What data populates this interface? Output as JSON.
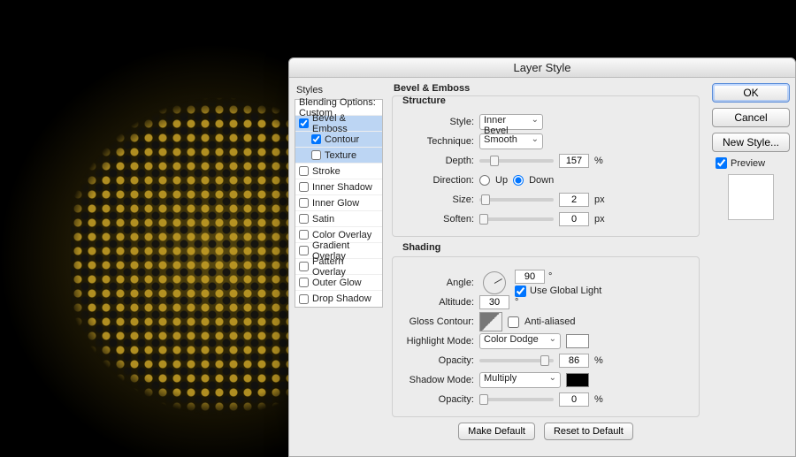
{
  "dialog": {
    "title": "Layer Style",
    "styles_label": "Styles",
    "blending_label": "Blending Options: Custom",
    "effects": [
      {
        "label": "Bevel & Emboss",
        "checked": true,
        "selected": true
      },
      {
        "label": "Contour",
        "checked": true,
        "sub": true,
        "selected": true
      },
      {
        "label": "Texture",
        "checked": false,
        "sub": true,
        "selected": true
      },
      {
        "label": "Stroke",
        "checked": false
      },
      {
        "label": "Inner Shadow",
        "checked": false
      },
      {
        "label": "Inner Glow",
        "checked": false
      },
      {
        "label": "Satin",
        "checked": false
      },
      {
        "label": "Color Overlay",
        "checked": false
      },
      {
        "label": "Gradient Overlay",
        "checked": false
      },
      {
        "label": "Pattern Overlay",
        "checked": false
      },
      {
        "label": "Outer Glow",
        "checked": false
      },
      {
        "label": "Drop Shadow",
        "checked": false
      }
    ]
  },
  "structure": {
    "section": "Bevel & Emboss",
    "sub": "Structure",
    "style_lbl": "Style:",
    "style_val": "Inner Bevel",
    "technique_lbl": "Technique:",
    "technique_val": "Smooth",
    "depth_lbl": "Depth:",
    "depth_val": "157",
    "depth_unit": "%",
    "direction_lbl": "Direction:",
    "up": "Up",
    "down": "Down",
    "size_lbl": "Size:",
    "size_val": "2",
    "size_unit": "px",
    "soften_lbl": "Soften:",
    "soften_val": "0",
    "soften_unit": "px"
  },
  "shading": {
    "sub": "Shading",
    "angle_lbl": "Angle:",
    "angle_val": "90",
    "global": "Use Global Light",
    "altitude_lbl": "Altitude:",
    "altitude_val": "30",
    "gloss_lbl": "Gloss Contour:",
    "anti": "Anti-aliased",
    "hmode_lbl": "Highlight Mode:",
    "hmode_val": "Color Dodge",
    "hcolor": "#ffffff",
    "hopacity_lbl": "Opacity:",
    "hopacity_val": "86",
    "opacity_unit": "%",
    "smode_lbl": "Shadow Mode:",
    "smode_val": "Multiply",
    "scolor": "#000000",
    "sopacity_lbl": "Opacity:",
    "sopacity_val": "0"
  },
  "footer": {
    "default": "Make Default",
    "reset": "Reset to Default"
  },
  "right": {
    "ok": "OK",
    "cancel": "Cancel",
    "newstyle": "New Style...",
    "preview": "Preview"
  }
}
